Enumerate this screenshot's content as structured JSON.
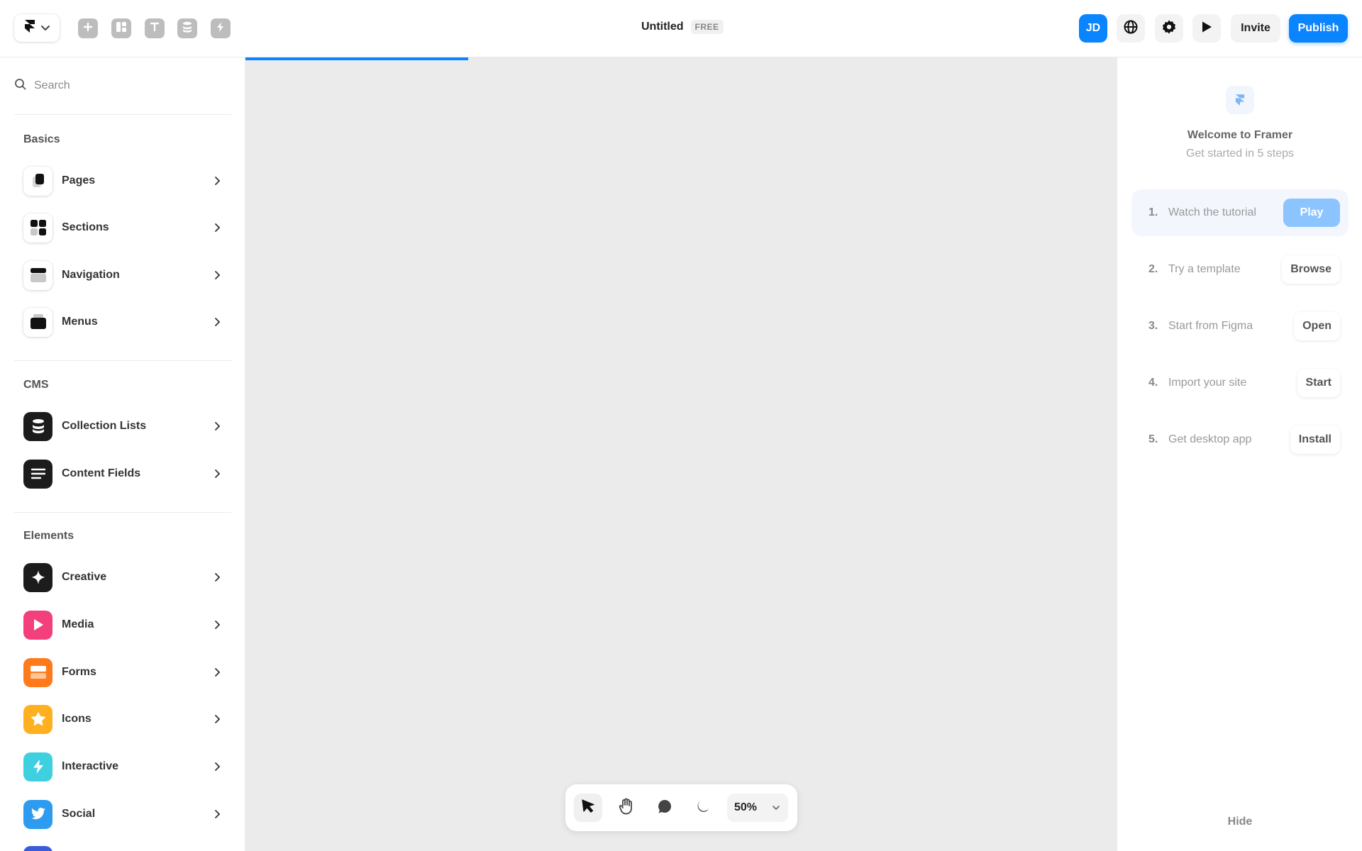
{
  "header": {
    "doc_title": "Untitled",
    "plan_badge": "FREE",
    "avatar_initials": "JD",
    "invite_label": "Invite",
    "publish_label": "Publish",
    "accent_color": "#0a84ff"
  },
  "sidebar": {
    "search_placeholder": "Search",
    "sections": {
      "basics": "Basics",
      "cms": "CMS",
      "elements": "Elements"
    },
    "basics_items": [
      {
        "label": "Pages"
      },
      {
        "label": "Sections"
      },
      {
        "label": "Navigation"
      },
      {
        "label": "Menus"
      }
    ],
    "cms_items": [
      {
        "label": "Collection Lists"
      },
      {
        "label": "Content Fields"
      }
    ],
    "element_items": [
      {
        "label": "Creative",
        "color": "#1c1c1c"
      },
      {
        "label": "Media",
        "color": "#f43f7d"
      },
      {
        "label": "Forms",
        "color": "#ff7a1a"
      },
      {
        "label": "Icons",
        "color": "#ffb020"
      },
      {
        "label": "Interactive",
        "color": "#3fd0e0"
      },
      {
        "label": "Social",
        "color": "#2d9cf0"
      }
    ]
  },
  "canvas": {
    "load_progress": 0.256,
    "zoom": "50%"
  },
  "onboarding": {
    "title": "Welcome to Framer",
    "subtitle": "Get started in 5 steps",
    "steps": [
      {
        "num": "1.",
        "label": "Watch the tutorial",
        "action": "Play"
      },
      {
        "num": "2.",
        "label": "Try a template",
        "action": "Browse"
      },
      {
        "num": "3.",
        "label": "Start from Figma",
        "action": "Open"
      },
      {
        "num": "4.",
        "label": "Import your site",
        "action": "Start"
      },
      {
        "num": "5.",
        "label": "Get desktop app",
        "action": "Install"
      }
    ],
    "hide_label": "Hide"
  }
}
